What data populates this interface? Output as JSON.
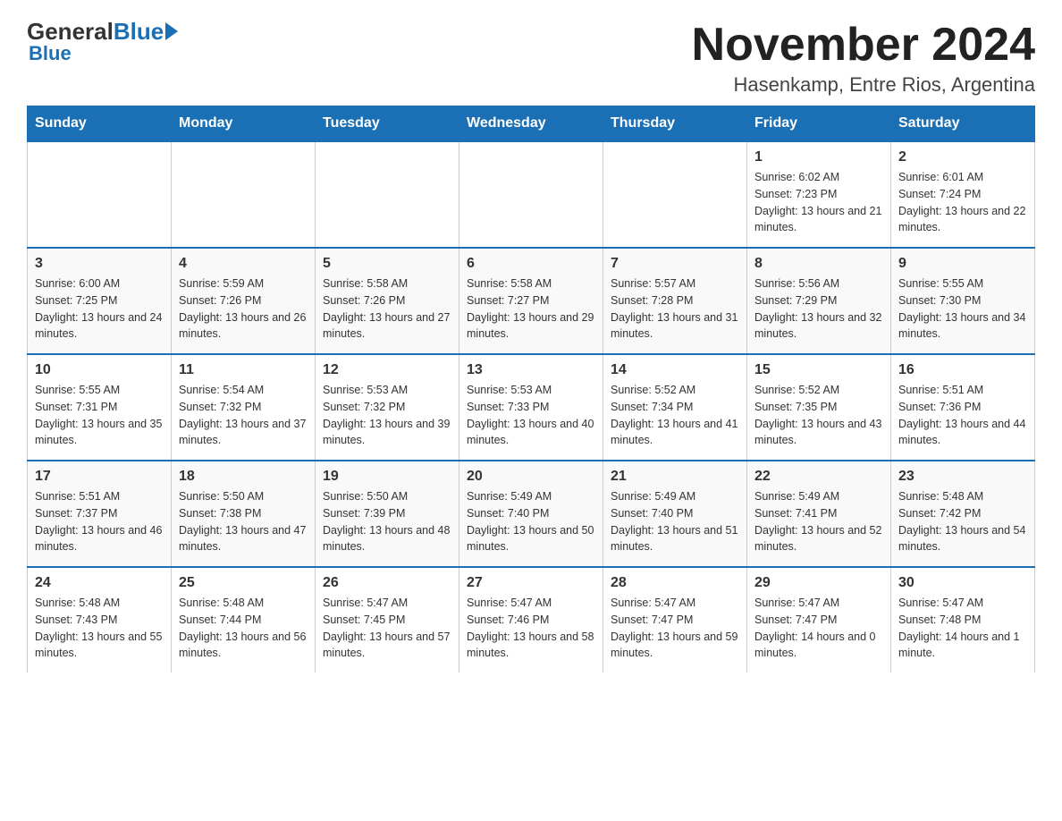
{
  "header": {
    "logo_general": "General",
    "logo_blue": "Blue",
    "month_title": "November 2024",
    "location": "Hasenkamp, Entre Rios, Argentina"
  },
  "days_of_week": [
    "Sunday",
    "Monday",
    "Tuesday",
    "Wednesday",
    "Thursday",
    "Friday",
    "Saturday"
  ],
  "weeks": [
    [
      {
        "day": "",
        "info": ""
      },
      {
        "day": "",
        "info": ""
      },
      {
        "day": "",
        "info": ""
      },
      {
        "day": "",
        "info": ""
      },
      {
        "day": "",
        "info": ""
      },
      {
        "day": "1",
        "info": "Sunrise: 6:02 AM\nSunset: 7:23 PM\nDaylight: 13 hours and 21 minutes."
      },
      {
        "day": "2",
        "info": "Sunrise: 6:01 AM\nSunset: 7:24 PM\nDaylight: 13 hours and 22 minutes."
      }
    ],
    [
      {
        "day": "3",
        "info": "Sunrise: 6:00 AM\nSunset: 7:25 PM\nDaylight: 13 hours and 24 minutes."
      },
      {
        "day": "4",
        "info": "Sunrise: 5:59 AM\nSunset: 7:26 PM\nDaylight: 13 hours and 26 minutes."
      },
      {
        "day": "5",
        "info": "Sunrise: 5:58 AM\nSunset: 7:26 PM\nDaylight: 13 hours and 27 minutes."
      },
      {
        "day": "6",
        "info": "Sunrise: 5:58 AM\nSunset: 7:27 PM\nDaylight: 13 hours and 29 minutes."
      },
      {
        "day": "7",
        "info": "Sunrise: 5:57 AM\nSunset: 7:28 PM\nDaylight: 13 hours and 31 minutes."
      },
      {
        "day": "8",
        "info": "Sunrise: 5:56 AM\nSunset: 7:29 PM\nDaylight: 13 hours and 32 minutes."
      },
      {
        "day": "9",
        "info": "Sunrise: 5:55 AM\nSunset: 7:30 PM\nDaylight: 13 hours and 34 minutes."
      }
    ],
    [
      {
        "day": "10",
        "info": "Sunrise: 5:55 AM\nSunset: 7:31 PM\nDaylight: 13 hours and 35 minutes."
      },
      {
        "day": "11",
        "info": "Sunrise: 5:54 AM\nSunset: 7:32 PM\nDaylight: 13 hours and 37 minutes."
      },
      {
        "day": "12",
        "info": "Sunrise: 5:53 AM\nSunset: 7:32 PM\nDaylight: 13 hours and 39 minutes."
      },
      {
        "day": "13",
        "info": "Sunrise: 5:53 AM\nSunset: 7:33 PM\nDaylight: 13 hours and 40 minutes."
      },
      {
        "day": "14",
        "info": "Sunrise: 5:52 AM\nSunset: 7:34 PM\nDaylight: 13 hours and 41 minutes."
      },
      {
        "day": "15",
        "info": "Sunrise: 5:52 AM\nSunset: 7:35 PM\nDaylight: 13 hours and 43 minutes."
      },
      {
        "day": "16",
        "info": "Sunrise: 5:51 AM\nSunset: 7:36 PM\nDaylight: 13 hours and 44 minutes."
      }
    ],
    [
      {
        "day": "17",
        "info": "Sunrise: 5:51 AM\nSunset: 7:37 PM\nDaylight: 13 hours and 46 minutes."
      },
      {
        "day": "18",
        "info": "Sunrise: 5:50 AM\nSunset: 7:38 PM\nDaylight: 13 hours and 47 minutes."
      },
      {
        "day": "19",
        "info": "Sunrise: 5:50 AM\nSunset: 7:39 PM\nDaylight: 13 hours and 48 minutes."
      },
      {
        "day": "20",
        "info": "Sunrise: 5:49 AM\nSunset: 7:40 PM\nDaylight: 13 hours and 50 minutes."
      },
      {
        "day": "21",
        "info": "Sunrise: 5:49 AM\nSunset: 7:40 PM\nDaylight: 13 hours and 51 minutes."
      },
      {
        "day": "22",
        "info": "Sunrise: 5:49 AM\nSunset: 7:41 PM\nDaylight: 13 hours and 52 minutes."
      },
      {
        "day": "23",
        "info": "Sunrise: 5:48 AM\nSunset: 7:42 PM\nDaylight: 13 hours and 54 minutes."
      }
    ],
    [
      {
        "day": "24",
        "info": "Sunrise: 5:48 AM\nSunset: 7:43 PM\nDaylight: 13 hours and 55 minutes."
      },
      {
        "day": "25",
        "info": "Sunrise: 5:48 AM\nSunset: 7:44 PM\nDaylight: 13 hours and 56 minutes."
      },
      {
        "day": "26",
        "info": "Sunrise: 5:47 AM\nSunset: 7:45 PM\nDaylight: 13 hours and 57 minutes."
      },
      {
        "day": "27",
        "info": "Sunrise: 5:47 AM\nSunset: 7:46 PM\nDaylight: 13 hours and 58 minutes."
      },
      {
        "day": "28",
        "info": "Sunrise: 5:47 AM\nSunset: 7:47 PM\nDaylight: 13 hours and 59 minutes."
      },
      {
        "day": "29",
        "info": "Sunrise: 5:47 AM\nSunset: 7:47 PM\nDaylight: 14 hours and 0 minutes."
      },
      {
        "day": "30",
        "info": "Sunrise: 5:47 AM\nSunset: 7:48 PM\nDaylight: 14 hours and 1 minute."
      }
    ]
  ]
}
